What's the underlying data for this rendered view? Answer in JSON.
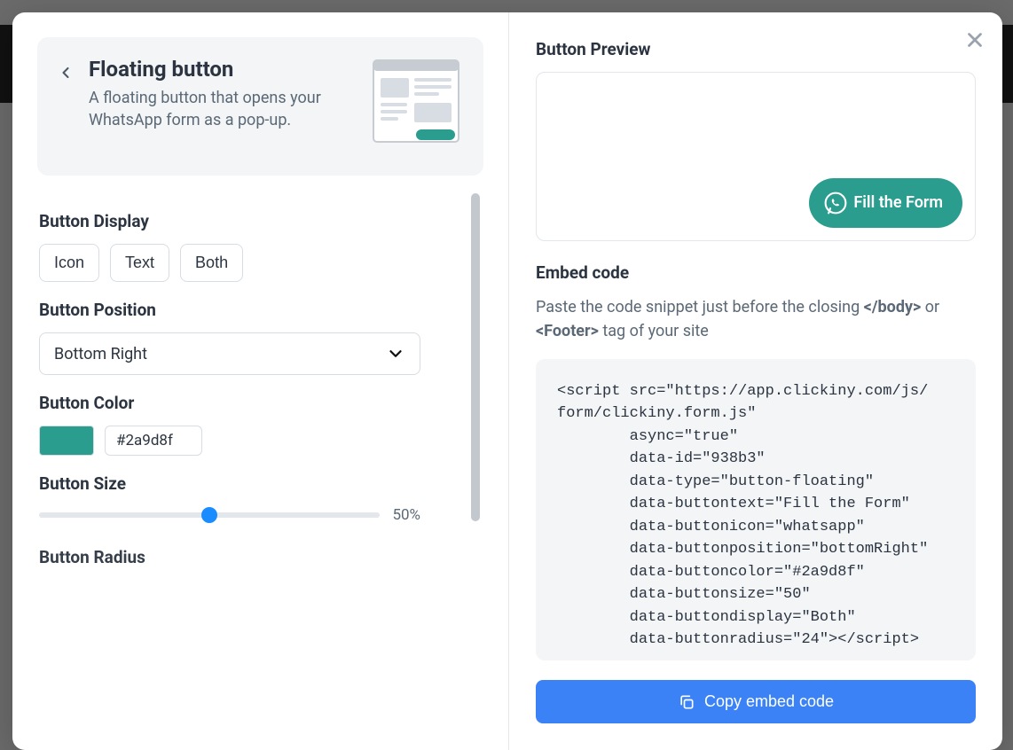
{
  "header": {
    "title": "Floating button",
    "subtitle": "A floating button that opens your WhatsApp form as a pop-up."
  },
  "settings": {
    "display": {
      "label": "Button Display",
      "options": [
        "Icon",
        "Text",
        "Both"
      ]
    },
    "position": {
      "label": "Button Position",
      "value": "Bottom Right"
    },
    "color": {
      "label": "Button Color",
      "hex": "#2a9d8f"
    },
    "size": {
      "label": "Button Size",
      "value_pct": "50%"
    },
    "radius": {
      "label": "Button Radius"
    }
  },
  "preview": {
    "title": "Button Preview",
    "button_label": "Fill the Form"
  },
  "embed": {
    "title": "Embed code",
    "hint_pre": "Paste the code snippet just before the closing ",
    "hint_tag1": "</body>",
    "hint_mid": " or ",
    "hint_tag2": "<Footer>",
    "hint_post": " tag of your site",
    "code": "<script src=\"https://app.clickiny.com/js/\nform/clickiny.form.js\"\n        async=\"true\"\n        data-id=\"938b3\"\n        data-type=\"button-floating\"\n        data-buttontext=\"Fill the Form\"\n        data-buttonicon=\"whatsapp\"\n        data-buttonposition=\"bottomRight\"\n        data-buttoncolor=\"#2a9d8f\"\n        data-buttonsize=\"50\"\n        data-buttondisplay=\"Both\"\n        data-buttonradius=\"24\"></script>",
    "copy_label": "Copy embed code"
  }
}
